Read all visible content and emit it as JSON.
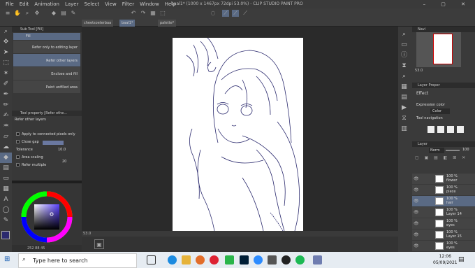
{
  "window": {
    "title": "baal1* (1000 x 1467px 72dpi 53.0%) - CLIP STUDIO PAINT PRO",
    "controls": "– ▢ ✕"
  },
  "menu": [
    "File",
    "Edit",
    "Animation",
    "Layer",
    "Select",
    "View",
    "Filter",
    "Window",
    "Help"
  ],
  "tabs": [
    {
      "label": "cheetsoeterbaa"
    },
    {
      "label": "baal1*"
    },
    {
      "label": "palette*"
    }
  ],
  "subtool": {
    "title": "Sub Tool [Fill]",
    "items": [
      {
        "label": "Fill"
      },
      {
        "label": "Refer only to editing layer"
      },
      {
        "label": "Refer other layers"
      },
      {
        "label": "Enclose and fill"
      },
      {
        "label": "Paint unfilled area"
      }
    ]
  },
  "toolprop": {
    "title": "Tool property [Refer othe...",
    "subtitle": "Refer other layers",
    "rows": [
      {
        "label": "Apply to connected pixels only"
      },
      {
        "label": "Close gap"
      },
      {
        "label": "Tolerance",
        "value": "10.0"
      },
      {
        "label": "Area scaling",
        "value": "20"
      },
      {
        "label": "Refer multiple"
      }
    ]
  },
  "status": {
    "zoom": "53.0",
    "colorvals": "252 88 45"
  },
  "navigator": {
    "title": "Navi",
    "zoom": "53.0"
  },
  "layerprop": {
    "title": "Layer Proper",
    "effect": "Effect",
    "expression_label": "Expression color",
    "expression_value": "Color",
    "tool_nav": "Tool navigation"
  },
  "layers": {
    "title": "Layer",
    "blend": "Norm",
    "opacity": "100",
    "items": [
      {
        "pct": "100 %",
        "name": "flower"
      },
      {
        "pct": "100 %",
        "name": "piece"
      },
      {
        "pct": "100 %",
        "name": "hair"
      },
      {
        "pct": "100 %",
        "name": "Layer 14"
      },
      {
        "pct": "100 %",
        "name": "eyes"
      },
      {
        "pct": "100 %",
        "name": "Layer 15"
      },
      {
        "pct": "100 %",
        "name": "eyes"
      }
    ]
  },
  "taskbar": {
    "search_placeholder": "Type here to search",
    "time": "12:06",
    "date": "05/09/2021"
  },
  "colors": {
    "accent": "#5a6a84",
    "line": "#2b2a6e"
  }
}
